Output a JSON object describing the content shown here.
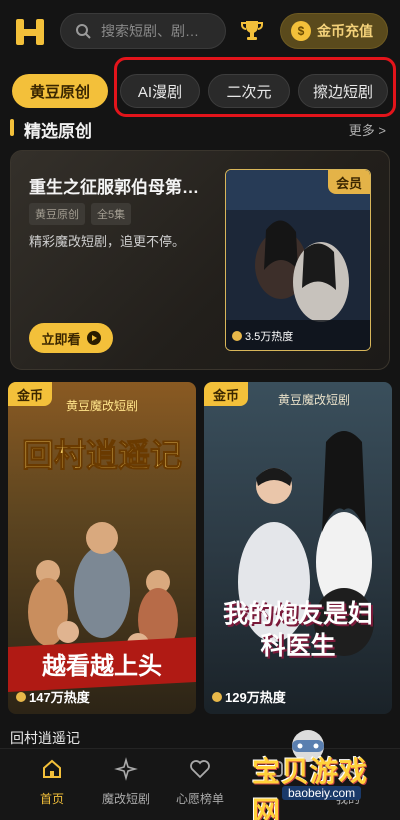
{
  "header": {
    "search_placeholder": "搜索短剧、剧…",
    "recharge_label": "金币充值",
    "coin_symbol": "$"
  },
  "categories": [
    {
      "label": "黄豆原创",
      "active": true
    },
    {
      "label": "AI漫剧",
      "active": false
    },
    {
      "label": "二次元",
      "active": false
    },
    {
      "label": "擦边短剧",
      "active": false
    }
  ],
  "section": {
    "title": "精选原创",
    "more": "更多 >"
  },
  "featured": {
    "title": "重生之征服郭伯母第…",
    "tags": [
      "黄豆原创",
      "全5集"
    ],
    "description": "精彩魔改短剧，追更不停。",
    "watch_label": "立即看",
    "badge": "会员",
    "heat": "3.5万热度"
  },
  "grid": [
    {
      "badge": "金币",
      "heat": "147万热度",
      "title": "回村逍遥记",
      "poster_title": "回村逍遥记",
      "poster_slogan": "越看越上头",
      "poster_series": "黄豆魔改短剧"
    },
    {
      "badge": "金币",
      "heat": "129万热度",
      "title": "",
      "poster_title": "我的炮友是妇科医生",
      "poster_series": "黄豆魔改短剧"
    }
  ],
  "bottom_nav": [
    {
      "label": "首页",
      "icon": "home-icon",
      "active": true
    },
    {
      "label": "魔改短剧",
      "icon": "sparkle-icon",
      "active": false
    },
    {
      "label": "心愿榜单",
      "icon": "heart-icon",
      "active": false
    },
    {
      "label": "",
      "icon": "tab-icon",
      "active": false
    },
    {
      "label": "我的",
      "icon": "profile-icon",
      "active": false
    }
  ],
  "watermark": {
    "text": "宝贝游戏网",
    "url": "baobeiy.com"
  },
  "colors": {
    "accent": "#f3c03a",
    "highlight_box": "#e3141b",
    "background": "#141414"
  }
}
